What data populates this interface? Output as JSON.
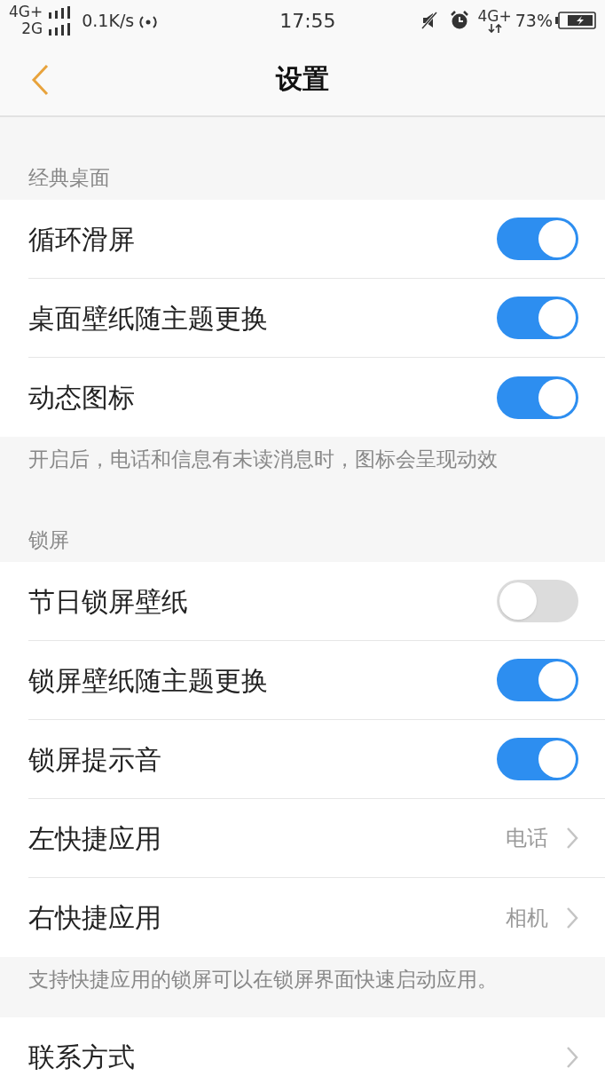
{
  "status_bar": {
    "network_top": "4G+",
    "network_bottom": "2G",
    "speed": "0.1K/s",
    "time": "17:55",
    "network_right": "4G+",
    "battery": "73%"
  },
  "header": {
    "title": "设置"
  },
  "sections": [
    {
      "title": "经典桌面",
      "items": [
        {
          "kind": "toggle",
          "label": "循环滑屏",
          "on": true
        },
        {
          "kind": "toggle",
          "label": "桌面壁纸随主题更换",
          "on": true
        },
        {
          "kind": "toggle",
          "label": "动态图标",
          "on": true
        }
      ],
      "note": "开启后，电话和信息有未读消息时，图标会呈现动效"
    },
    {
      "title": "锁屏",
      "items": [
        {
          "kind": "toggle",
          "label": "节日锁屏壁纸",
          "on": false
        },
        {
          "kind": "toggle",
          "label": "锁屏壁纸随主题更换",
          "on": true
        },
        {
          "kind": "toggle",
          "label": "锁屏提示音",
          "on": true
        },
        {
          "kind": "link",
          "label": "左快捷应用",
          "value": "电话"
        },
        {
          "kind": "link",
          "label": "右快捷应用",
          "value": "相机"
        }
      ],
      "note": "支持快捷应用的锁屏可以在锁屏界面快速启动应用。"
    },
    {
      "items": [
        {
          "kind": "link",
          "label": "联系方式"
        }
      ]
    }
  ]
}
